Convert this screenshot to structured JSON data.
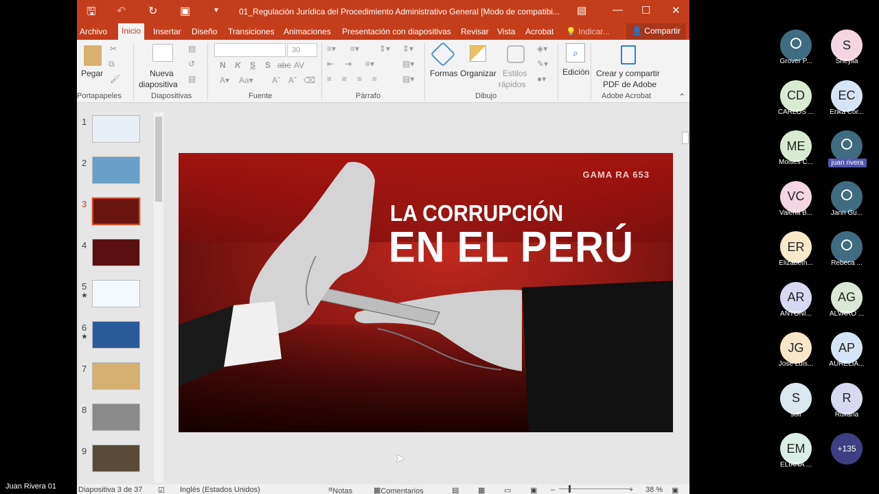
{
  "window": {
    "title": "01_Regulación Jurídica del Procedimiento Administrativo General [Modo de compatibi...",
    "share_label": "Compartir",
    "tell_me_label": "Indicar...",
    "icons": {
      "save": "save-icon",
      "undo": "undo-icon",
      "redo": "redo-icon",
      "present": "present-icon",
      "qat_more": "chevron-down-icon"
    }
  },
  "ribbon": {
    "tabs": [
      "Archivo",
      "Inicio",
      "Insertar",
      "Diseño",
      "Transiciones",
      "Animaciones",
      "Presentación con diapositivas",
      "Revisar",
      "Vista",
      "Acrobat"
    ],
    "active_tab": "Inicio",
    "paste_label": "Pegar",
    "new_slide_label": [
      "Nueva",
      "diapositiva"
    ],
    "font_size": "30",
    "shapes_label": "Formas",
    "arrange_label": "Organizar",
    "quick_styles_label": [
      "Estilos",
      "rápidos"
    ],
    "editing_label": "Edición",
    "acrobat_label": [
      "Crear y compartir",
      "PDF de Adobe"
    ],
    "groups": [
      "Portapapeles",
      "Diapositivas",
      "Fuente",
      "Párrafo",
      "Dibujo",
      "Adobe Acrobat"
    ],
    "font_buttons": [
      "N",
      "K",
      "S",
      "S",
      "abc",
      "AV"
    ]
  },
  "thumbnails": [
    {
      "num": "1",
      "star": ""
    },
    {
      "num": "2",
      "star": ""
    },
    {
      "num": "3",
      "star": "",
      "selected": true
    },
    {
      "num": "4",
      "star": ""
    },
    {
      "num": "5",
      "star": "★"
    },
    {
      "num": "6",
      "star": "★"
    },
    {
      "num": "7",
      "star": ""
    },
    {
      "num": "8",
      "star": ""
    },
    {
      "num": "9",
      "star": ""
    }
  ],
  "slide": {
    "title_line1": "LA CORRUPCIÓN",
    "title_line2": "EN EL PERÚ",
    "sign_text": "GAMA  RA 653",
    "colors": {
      "red": "#c0281f",
      "dark": "#3a0907"
    }
  },
  "status": {
    "slide_info": "Diapositiva 3 de 37",
    "language": "Inglés (Estados Unidos)",
    "notes_label": "Notas",
    "comments_label": "Comentarios",
    "zoom": "38 %"
  },
  "participants": [
    {
      "initials": "",
      "name": "Grover P...",
      "generic": true,
      "color": "#3f6c80"
    },
    {
      "initials": "S",
      "name": "Sheylla",
      "color": "#f4d6e3"
    },
    {
      "initials": "CD",
      "name": "CARLOS ...",
      "color": "#d9ead2"
    },
    {
      "initials": "EC",
      "name": "Erika Cor...",
      "color": "#d5e4f4"
    },
    {
      "initials": "ME",
      "name": "Moises C...",
      "color": "#d9ead2"
    },
    {
      "initials": "",
      "name": "juan rivera",
      "generic": true,
      "highlight": true,
      "color": "#3f6c80"
    },
    {
      "initials": "VC",
      "name": "Valeria B...",
      "color": "#f4d6e3"
    },
    {
      "initials": "",
      "name": "Jann Gu...",
      "generic": true,
      "color": "#3f6c80"
    },
    {
      "initials": "ER",
      "name": "Elizabeth...",
      "color": "#f8eac9"
    },
    {
      "initials": "",
      "name": "Rebeca ...",
      "generic": true,
      "color": "#3f6c80"
    },
    {
      "initials": "AR",
      "name": "ANTONI...",
      "color": "#d7d9f0"
    },
    {
      "initials": "AG",
      "name": "ALVARO ...",
      "color": "#dbe7d6"
    },
    {
      "initials": "JG",
      "name": "Jose Luis...",
      "color": "#f8e6c8"
    },
    {
      "initials": "AP",
      "name": "AURELIA...",
      "color": "#d5e4f4"
    },
    {
      "initials": "S",
      "name": "sofi",
      "color": "#dbe7ee"
    },
    {
      "initials": "R",
      "name": "Roxana",
      "color": "#d7d9f0"
    },
    {
      "initials": "EM",
      "name": "ELIANA ...",
      "color": "#dbeee6"
    },
    {
      "initials": "+135",
      "name": "",
      "more": true,
      "color": "#3d3f82"
    }
  ],
  "self_name": "Juan Rivera 01"
}
